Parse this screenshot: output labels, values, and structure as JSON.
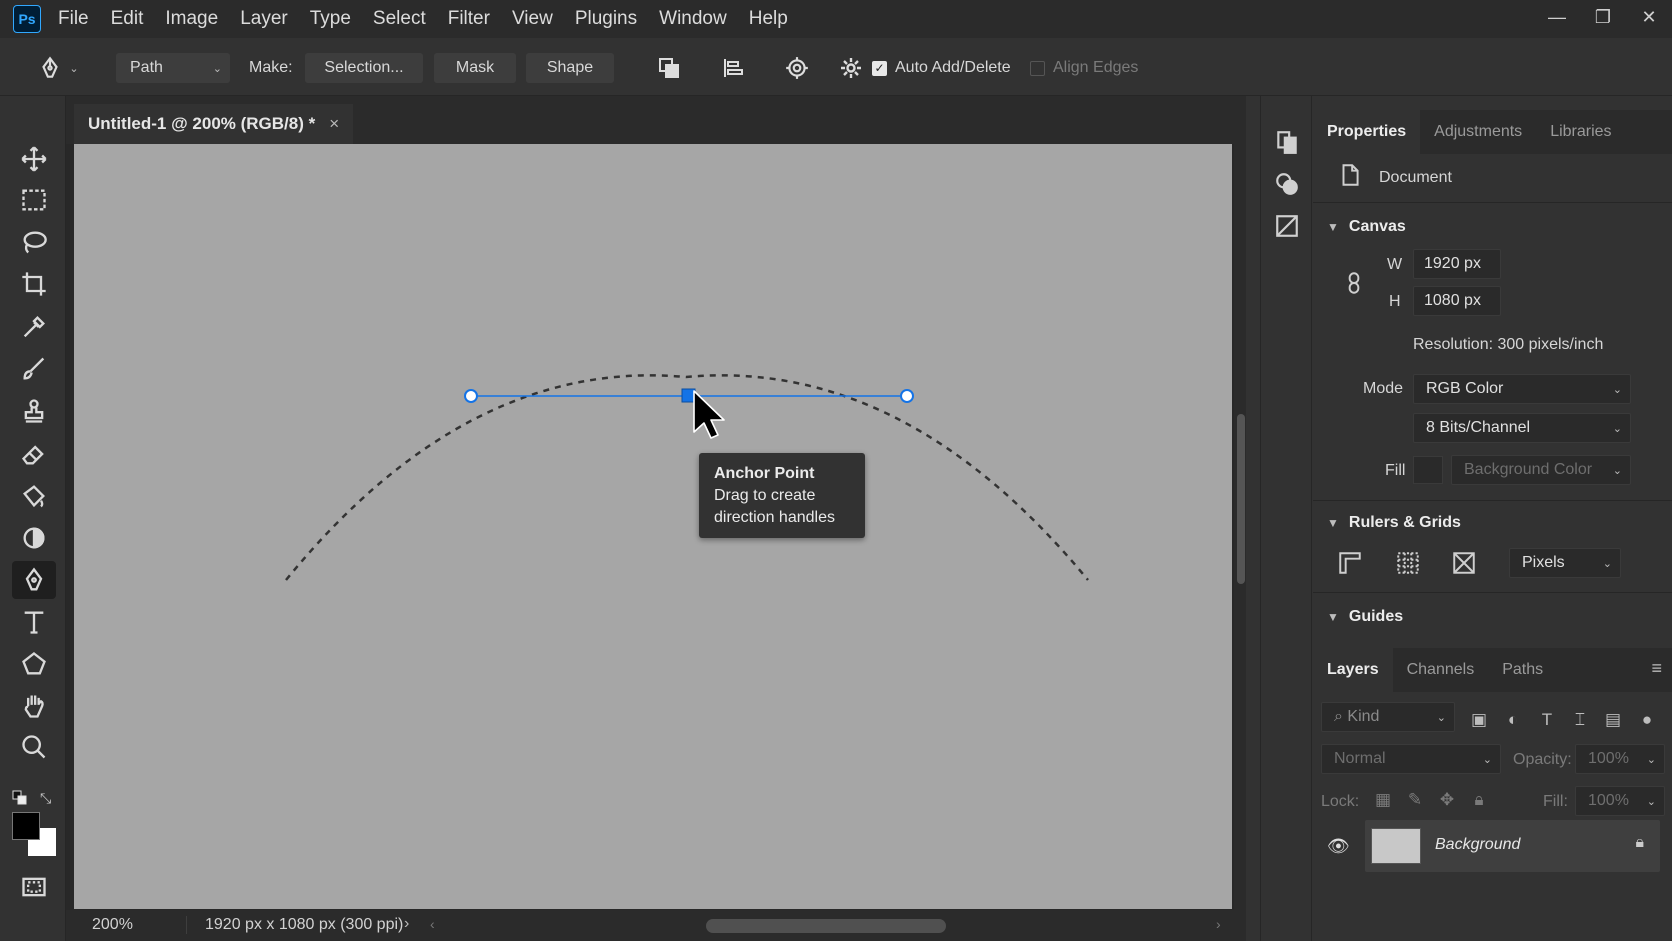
{
  "app": {
    "logo_text": "Ps",
    "menu": [
      "File",
      "Edit",
      "Image",
      "Layer",
      "Type",
      "Select",
      "Filter",
      "View",
      "Plugins",
      "Window",
      "Help"
    ],
    "accent_color": "#31a8ff"
  },
  "options_bar": {
    "mode_select": "Path",
    "make_label": "Make:",
    "selection_button": "Selection...",
    "mask_button": "Mask",
    "shape_button": "Shape",
    "auto_add_delete_label": "Auto Add/Delete",
    "auto_add_delete_checked": true,
    "align_edges_label": "Align Edges",
    "align_edges_checked": false
  },
  "document": {
    "tab_title": "Untitled-1 @ 200% (RGB/8) *",
    "tab_close": "×",
    "zoom": "200%",
    "size_info": "1920 px x 1080 px (300 ppi)"
  },
  "tooltip": {
    "title": "Anchor Point",
    "line1": "Drag to create",
    "line2": "direction handles"
  },
  "properties": {
    "tabs": [
      "Properties",
      "Adjustments",
      "Libraries"
    ],
    "document_label": "Document",
    "canvas_section": "Canvas",
    "w_label": "W",
    "w_value": "1920 px",
    "h_label": "H",
    "h_value": "1080 px",
    "resolution": "Resolution: 300 pixels/inch",
    "mode_label": "Mode",
    "mode_value": "RGB Color",
    "bits_value": "8 Bits/Channel",
    "fill_label": "Fill",
    "fill_value": "Background Color",
    "rulers_section": "Rulers & Grids",
    "units_value": "Pixels",
    "guides_section": "Guides"
  },
  "layers": {
    "tabs": [
      "Layers",
      "Channels",
      "Paths"
    ],
    "filter_placeholder": "Kind",
    "blend_mode": "Normal",
    "opacity_label": "Opacity:",
    "opacity_value": "100%",
    "lock_label": "Lock:",
    "fill_label": "Fill:",
    "fill_value": "100%",
    "items": [
      {
        "name": "Background",
        "visible": true,
        "locked": true
      }
    ]
  }
}
